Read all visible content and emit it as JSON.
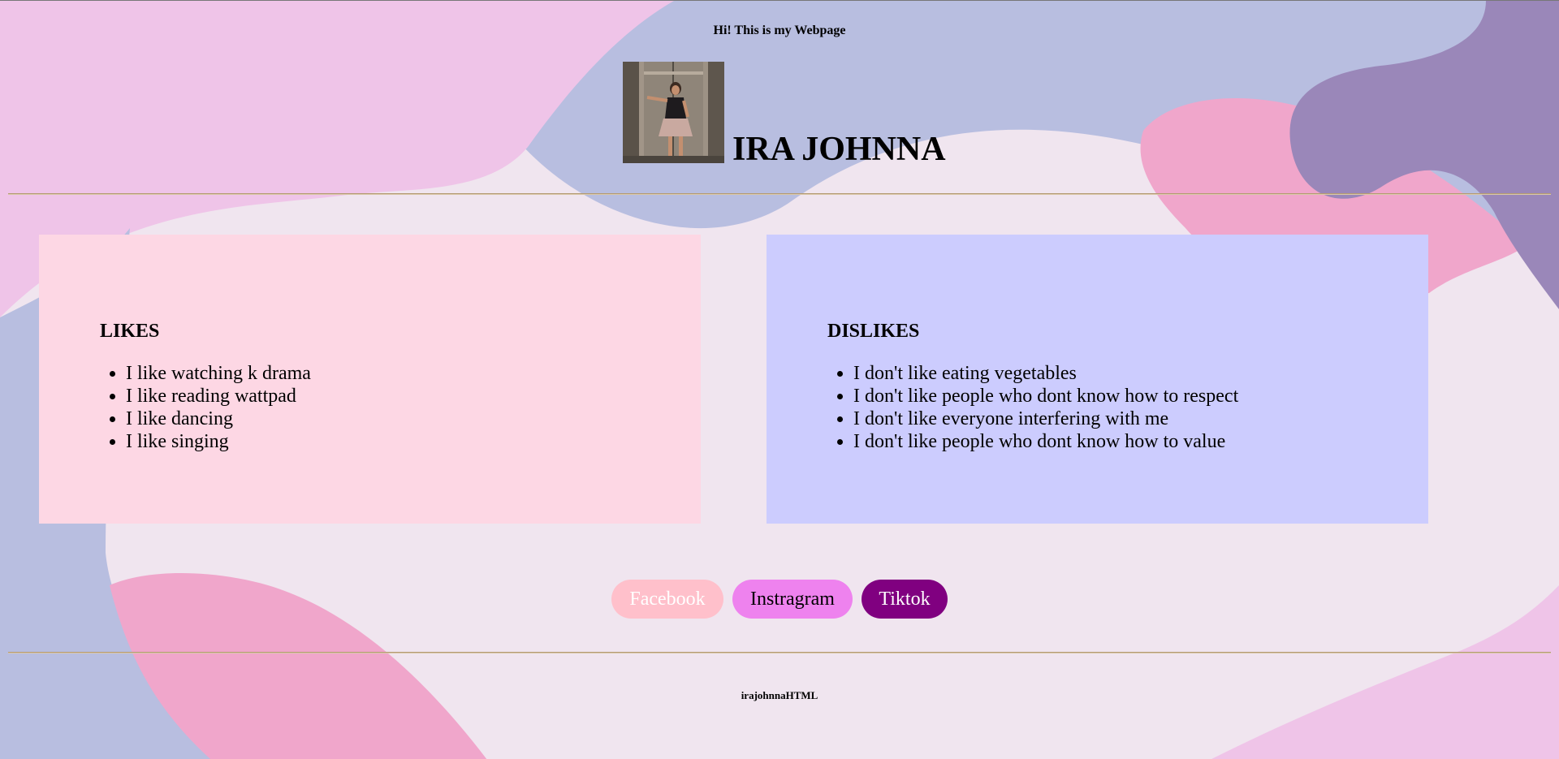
{
  "header": {
    "greeting": "Hi! This is my Webpage",
    "name": "IRA JOHNNA"
  },
  "likes": {
    "heading": "LIKES",
    "items": [
      "I like watching k drama",
      "I like reading wattpad",
      "I like dancing",
      "I like singing"
    ]
  },
  "dislikes": {
    "heading": "DISLIKES",
    "items": [
      "I don't like eating vegetables",
      "I don't like people who dont know how to respect",
      "I don't like everyone interfering with me",
      "I don't like people who dont know how to value"
    ]
  },
  "socials": {
    "facebook": "Facebook",
    "instagram": "Instragram",
    "tiktok": "Tiktok"
  },
  "footer": {
    "text": "irajohnnaHTML"
  },
  "colors": {
    "page_bg": "#f0e5ef",
    "blob_pink_light": "#efc4e8",
    "blob_blue": "#b8bee0",
    "blob_pink": "#f0a6cb",
    "blob_purple": "#9a87b9",
    "likes_card": "#fdd7e4",
    "dislikes_card": "#ccccfe",
    "facebook_btn": "#ffc0cb",
    "instagram_btn": "#ee82ee",
    "tiktok_btn": "#800080"
  }
}
